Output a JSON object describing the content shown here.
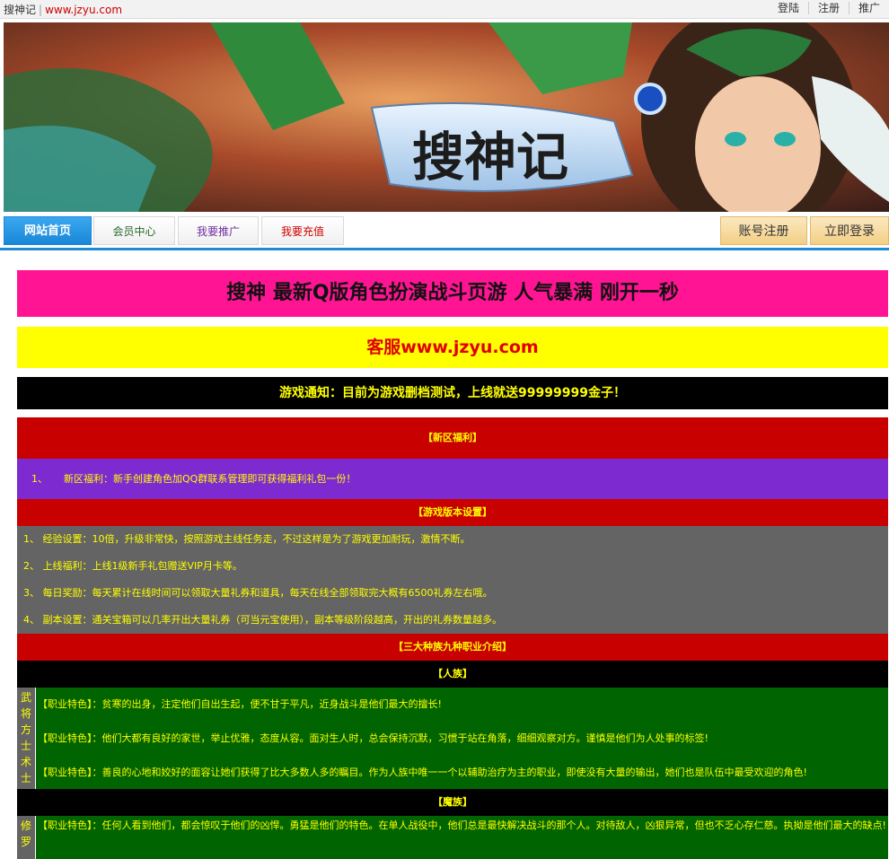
{
  "topbar": {
    "site_name": "搜神记",
    "separator": "|",
    "site_url": "www.jzyu.com",
    "links": [
      "登陆",
      "注册",
      "推广"
    ]
  },
  "banner": {
    "logo_text": "搜神记"
  },
  "nav": {
    "tabs": [
      "网站首页",
      "会员中心",
      "我要推广",
      "我要充值"
    ],
    "right_buttons": [
      "账号注册",
      "立即登录"
    ]
  },
  "headers": {
    "main_title": "搜神 最新Q版角色扮演战斗页游 人气暴满 刚开一秒",
    "service": "客服www.jzyu.com",
    "notice": "游戏通知：目前为游戏删档测试，上线就送99999999金子！"
  },
  "sections": {
    "new_server_title": "【新区福利】",
    "new_server_item_num": "1、",
    "new_server_item": "新区福利：新手创建角色加QQ群联系管理即可获得福利礼包一份！",
    "version_title": "【游戏版本设置】",
    "version_items": [
      "1、  经验设置：10倍，升级非常快，按照游戏主线任务走，不过这样是为了游戏更加耐玩，激情不断。",
      "2、  上线福利：上线1级新手礼包赠送VIP月卡等。",
      "3、  每日奖励：每天累计在线时间可以领取大量礼券和道具，每天在线全部领取完大概有6500礼券左右哦。",
      "4、  副本设置：通关宝箱可以几率开出大量礼券（可当元宝使用），副本等级阶段越高，开出的礼券数量越多。"
    ],
    "races_title": "【三大种族九种职业介绍】",
    "human_title": "【人族】",
    "human_classes": [
      "武将",
      "方士",
      "术士"
    ],
    "human_items": [
      "【职业特色】：贫寒的出身，注定他们自出生起，便不甘于平凡，近身战斗是他们最大的擅长!",
      "【职业特色】：他们大都有良好的家世，举止优雅，态度从容。面对生人时，总会保持沉默，习惯于站在角落，细细观察对方。谨慎是他们为人处事的标签!",
      "【职业特色】：善良的心地和姣好的面容让她们获得了比大多数人多的瞩目。作为人族中唯一一个以辅助治疗为主的职业，即使没有大量的输出，她们也是队伍中最受欢迎的角色!"
    ],
    "demon_title": "【魔族】",
    "demon_class": "修罗",
    "demon_item": "【职业特色】：任何人看到他们，都会惊叹于他们的凶悍。勇猛是他们的特色。在单人战役中，他们总是最快解决战斗的那个人。对待敌人，凶狠异常，但也不乏心存仁慈。执拗是他们最大的缺点!"
  },
  "colors": {
    "pink": "#ff1493",
    "yellow": "#ffff00",
    "red": "#c80000",
    "purple": "#7d2bd0",
    "gray": "#646464",
    "green": "#006400",
    "nav_blue": "#1f8ad6"
  }
}
